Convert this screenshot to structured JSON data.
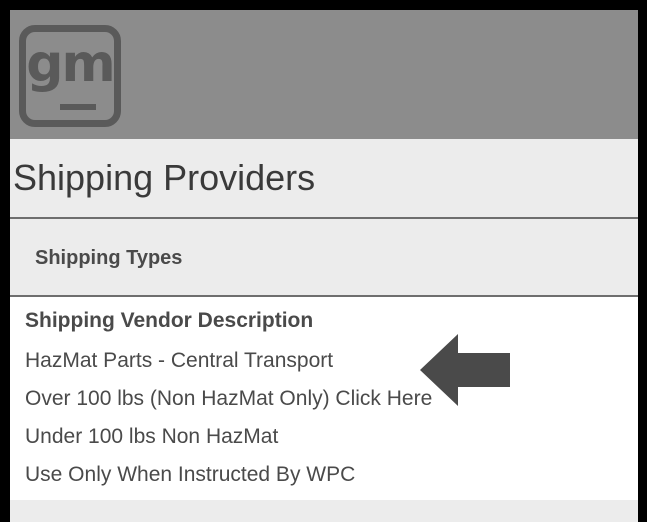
{
  "logo": {
    "text": "gm"
  },
  "page": {
    "title": "Shipping Providers"
  },
  "shipping_types": {
    "label": "Shipping Types"
  },
  "vendor_list": {
    "header": "Shipping Vendor Description",
    "items": [
      {
        "label": "HazMat Parts - Central Transport"
      },
      {
        "label": "Over 100 lbs (Non HazMat Only) Click Here"
      },
      {
        "label": "Under 100 lbs Non HazMat"
      },
      {
        "label": "Use Only When Instructed By WPC"
      }
    ]
  },
  "annotation": {
    "arrow_icon": "left-arrow-icon",
    "arrow_color": "#4a4a4a",
    "points_to_item": "HazMat Parts - Central Transport"
  },
  "colors": {
    "header_bg": "#8c8c8c",
    "logo": "#5a5a5a",
    "bar_bg": "#ececec",
    "text": "#4a4a4a",
    "frame": "#000000"
  }
}
